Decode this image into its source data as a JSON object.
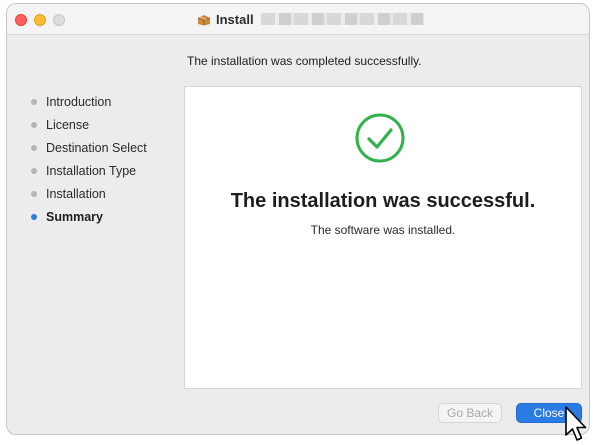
{
  "window": {
    "title_prefix": "Install",
    "title_icon": "package-icon"
  },
  "header": {
    "headline": "The installation was completed successfully."
  },
  "sidebar": {
    "steps": [
      {
        "label": "Introduction",
        "state": "done"
      },
      {
        "label": "License",
        "state": "done"
      },
      {
        "label": "Destination Select",
        "state": "done"
      },
      {
        "label": "Installation Type",
        "state": "done"
      },
      {
        "label": "Installation",
        "state": "done"
      },
      {
        "label": "Summary",
        "state": "active"
      }
    ]
  },
  "main": {
    "status_icon": "checkmark-circle-icon",
    "success_title": "The installation was successful.",
    "success_subtitle": "The software was installed."
  },
  "footer": {
    "back_label": "Go Back",
    "close_label": "Close"
  },
  "colors": {
    "accent": "#2a7be4",
    "success": "#2fb34a",
    "traffic_close": "#ff5f57",
    "traffic_minimize": "#febc2e"
  }
}
